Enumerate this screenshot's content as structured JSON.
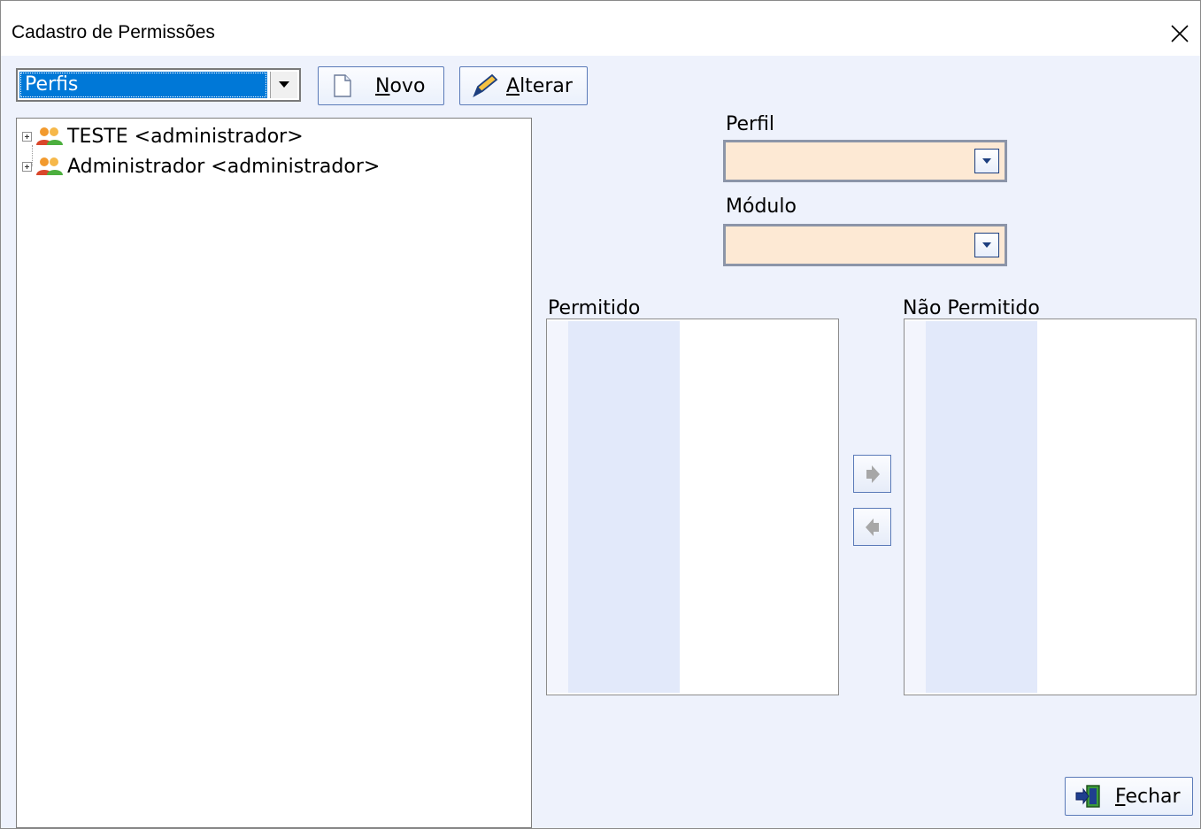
{
  "window": {
    "title": "Cadastro de Permissões"
  },
  "toolbar": {
    "type_selected": "Perfis",
    "novo_label": "Novo",
    "alterar_label": "Alterar"
  },
  "tree": {
    "items": [
      {
        "label": "TESTE <administrador>"
      },
      {
        "label": "Administrador <administrador>"
      }
    ]
  },
  "form": {
    "perfil_label": "Perfil",
    "perfil_value": "",
    "modulo_label": "Módulo",
    "modulo_value": ""
  },
  "lists": {
    "permitido_label": "Permitido",
    "nao_permitido_label": "Não Permitido"
  },
  "footer": {
    "fechar_label": "Fechar"
  },
  "colors": {
    "accent": "#0078d7",
    "field_bg": "#fde9d4",
    "panel_bg": "#eef2fc"
  }
}
